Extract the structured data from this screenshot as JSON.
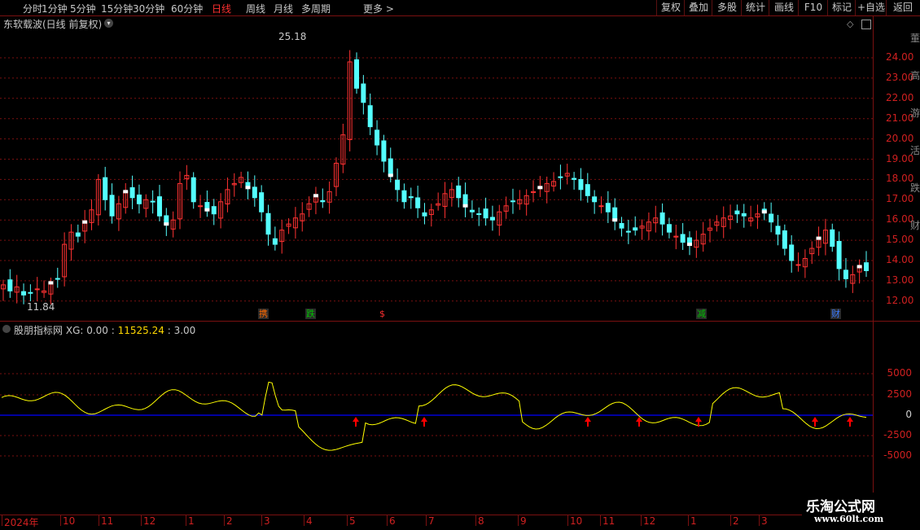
{
  "toolbar": {
    "periods": [
      "分时",
      "1分钟",
      "5分钟",
      "15分钟",
      "30分钟",
      "60分钟",
      "日线",
      "周线",
      "月线",
      "多周期",
      "更多 >"
    ],
    "active_period": "日线",
    "right_buttons": [
      "复权",
      "叠加",
      "多股",
      "统计",
      "画线",
      "F10",
      "标记",
      "+自选",
      "返回"
    ]
  },
  "chart_title": "东软载波(日线 前复权)",
  "price_axis": {
    "ticks": [
      "24.00",
      "23.00",
      "22.00",
      "21.00",
      "20.00",
      "19.00",
      "18.00",
      "17.00",
      "16.00",
      "15.00",
      "14.00",
      "13.00",
      "12.00"
    ],
    "high_marker": "25.18",
    "low_marker": "11.84"
  },
  "events": [
    {
      "text": "携",
      "color": "#ff6a00"
    },
    {
      "text": "跌",
      "color": "#00c000"
    },
    {
      "text": "$",
      "color": "#ff3030"
    },
    {
      "text": "减",
      "color": "#00c000"
    },
    {
      "text": "财",
      "color": "#3a7bff"
    }
  ],
  "indicator": {
    "name": "股朋指标网",
    "label": "XG: 0.00",
    "value": "11525.24",
    "third": "3.00",
    "ticks": [
      "5000",
      "2500",
      "0",
      "-2500",
      "-5000"
    ]
  },
  "x_axis": {
    "labels": [
      "2024年",
      "10",
      "11",
      "12",
      "1",
      "2",
      "3",
      "4",
      "5",
      "6",
      "7",
      "8",
      "9",
      "10",
      "11",
      "12",
      "1",
      "2",
      "3"
    ]
  },
  "watermark": {
    "line1": "乐淘公式网",
    "line2": "www.60lt.com"
  },
  "colors": {
    "up": "#ff3232",
    "down": "#54ffff",
    "indicator_line": "#ffff00",
    "zero_line": "#0000ff",
    "grid": "#7a1010",
    "arrow": "#ff0000"
  },
  "side_glyphs": [
    "董",
    "高",
    "游",
    "活",
    "跌",
    "财"
  ],
  "chart_data": {
    "type": "candlestick+line",
    "price_range": [
      11.84,
      25.18
    ],
    "closes": [
      12.8,
      12.5,
      12.7,
      12.3,
      12.4,
      12.6,
      12.5,
      12.9,
      13.1,
      14.8,
      15.4,
      15.2,
      15.9,
      16.5,
      18.0,
      17.0,
      16.2,
      16.8,
      17.4,
      17.1,
      16.8,
      17.0,
      16.9,
      16.2,
      15.8,
      16.0,
      17.8,
      18.2,
      16.9,
      16.7,
      16.5,
      16.3,
      16.9,
      17.5,
      17.8,
      18.1,
      17.6,
      17.1,
      16.4,
      15.3,
      14.8,
      15.5,
      15.8,
      16.1,
      16.3,
      16.8,
      17.2,
      16.9,
      17.4,
      18.8,
      20.2,
      23.8,
      22.5,
      21.8,
      20.6,
      19.7,
      18.9,
      18.2,
      17.5,
      16.9,
      17.1,
      16.6,
      16.2,
      16.5,
      16.8,
      17.3,
      17.5,
      17.1,
      16.7,
      16.4,
      16.3,
      16.1,
      16.0,
      16.4,
      16.7,
      16.9,
      17.0,
      17.2,
      17.4,
      17.6,
      17.8,
      17.9,
      18.1,
      18.3,
      18.0,
      17.5,
      17.2,
      16.9,
      16.7,
      16.4,
      16.0,
      15.6,
      15.4,
      15.5,
      15.7,
      15.9,
      16.1,
      15.8,
      15.4,
      15.2,
      14.9,
      14.8,
      15.0,
      15.3,
      15.6,
      15.9,
      16.1,
      16.2,
      16.3,
      16.2,
      16.1,
      16.3,
      16.4,
      15.9,
      15.3,
      14.6,
      14.0,
      13.8,
      14.1,
      14.6,
      15.1,
      15.5,
      14.7,
      13.6,
      13.1,
      13.3,
      13.7,
      13.5
    ]
  }
}
